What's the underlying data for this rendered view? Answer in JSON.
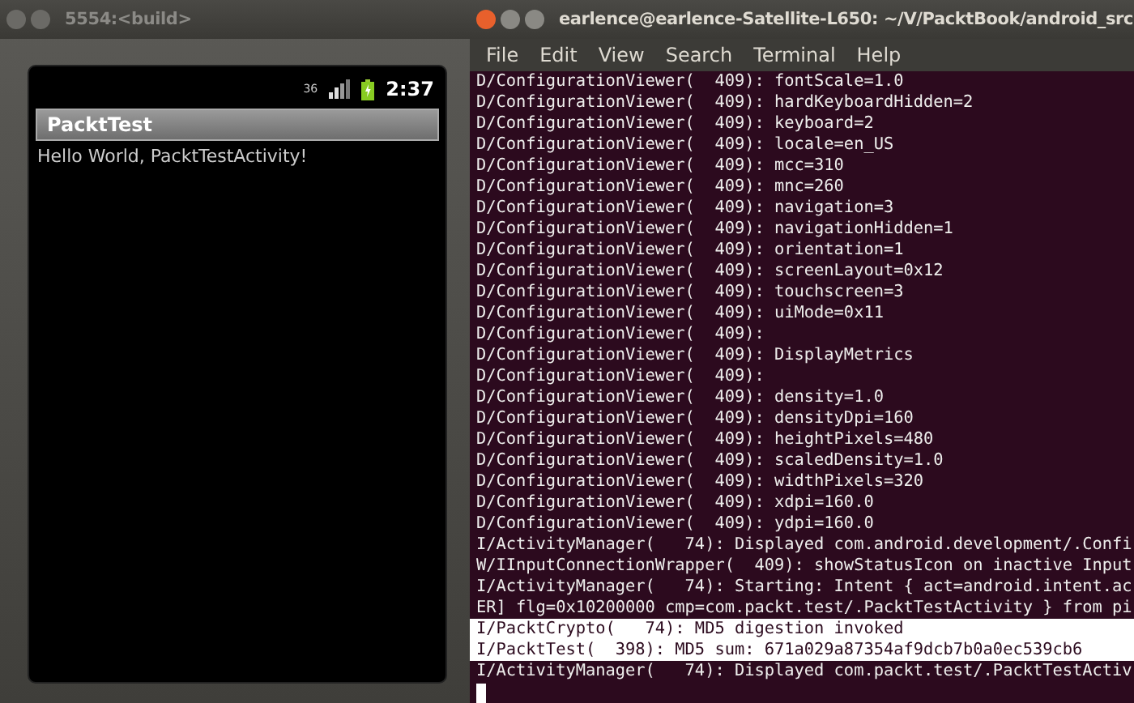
{
  "emulator": {
    "title": "5554:<build>",
    "status_bar": {
      "network": "36",
      "time": "2:37"
    },
    "app_title": "PacktTest",
    "message": "Hello World, PacktTestActivity!"
  },
  "terminal": {
    "title": "earlence@earlence-Satellite-L650: ~/V/PacktBook/android_src",
    "menu": [
      "File",
      "Edit",
      "View",
      "Search",
      "Terminal",
      "Help"
    ],
    "lines": [
      {
        "text": "D/ConfigurationViewer(  409): fontScale=1.0",
        "highlighted": false
      },
      {
        "text": "D/ConfigurationViewer(  409): hardKeyboardHidden=2",
        "highlighted": false
      },
      {
        "text": "D/ConfigurationViewer(  409): keyboard=2",
        "highlighted": false
      },
      {
        "text": "D/ConfigurationViewer(  409): locale=en_US",
        "highlighted": false
      },
      {
        "text": "D/ConfigurationViewer(  409): mcc=310",
        "highlighted": false
      },
      {
        "text": "D/ConfigurationViewer(  409): mnc=260",
        "highlighted": false
      },
      {
        "text": "D/ConfigurationViewer(  409): navigation=3",
        "highlighted": false
      },
      {
        "text": "D/ConfigurationViewer(  409): navigationHidden=1",
        "highlighted": false
      },
      {
        "text": "D/ConfigurationViewer(  409): orientation=1",
        "highlighted": false
      },
      {
        "text": "D/ConfigurationViewer(  409): screenLayout=0x12",
        "highlighted": false
      },
      {
        "text": "D/ConfigurationViewer(  409): touchscreen=3",
        "highlighted": false
      },
      {
        "text": "D/ConfigurationViewer(  409): uiMode=0x11",
        "highlighted": false
      },
      {
        "text": "D/ConfigurationViewer(  409):",
        "highlighted": false
      },
      {
        "text": "D/ConfigurationViewer(  409): DisplayMetrics",
        "highlighted": false
      },
      {
        "text": "D/ConfigurationViewer(  409):",
        "highlighted": false
      },
      {
        "text": "D/ConfigurationViewer(  409): density=1.0",
        "highlighted": false
      },
      {
        "text": "D/ConfigurationViewer(  409): densityDpi=160",
        "highlighted": false
      },
      {
        "text": "D/ConfigurationViewer(  409): heightPixels=480",
        "highlighted": false
      },
      {
        "text": "D/ConfigurationViewer(  409): scaledDensity=1.0",
        "highlighted": false
      },
      {
        "text": "D/ConfigurationViewer(  409): widthPixels=320",
        "highlighted": false
      },
      {
        "text": "D/ConfigurationViewer(  409): xdpi=160.0",
        "highlighted": false
      },
      {
        "text": "D/ConfigurationViewer(  409): ydpi=160.0",
        "highlighted": false
      },
      {
        "text": "I/ActivityManager(   74): Displayed com.android.development/.Confi",
        "highlighted": false
      },
      {
        "text": "W/IInputConnectionWrapper(  409): showStatusIcon on inactive Input",
        "highlighted": false
      },
      {
        "text": "I/ActivityManager(   74): Starting: Intent { act=android.intent.ac",
        "highlighted": false
      },
      {
        "text": "ER] flg=0x10200000 cmp=com.packt.test/.PacktTestActivity } from pi",
        "highlighted": false
      },
      {
        "text": "I/PacktCrypto(   74): MD5 digestion invoked",
        "highlighted": true
      },
      {
        "text": "I/PacktTest(  398): MD5 sum: 671a029a87354af9dcb7b0a0ec539cb6",
        "highlighted": true
      },
      {
        "text": "I/ActivityManager(   74): Displayed com.packt.test/.PacktTestActiv",
        "highlighted": false
      }
    ]
  }
}
